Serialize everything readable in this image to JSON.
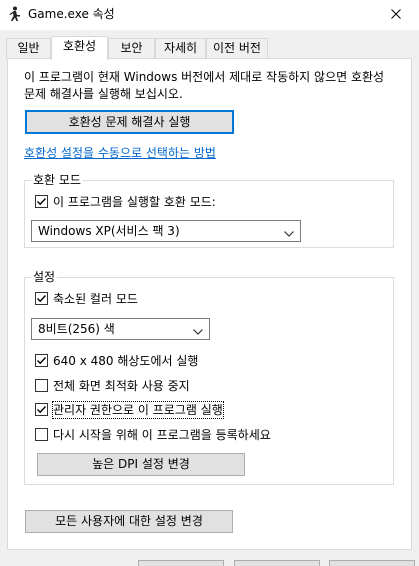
{
  "window": {
    "title": "Game.exe 속성"
  },
  "tabs": [
    {
      "label": "일반"
    },
    {
      "label": "호환성"
    },
    {
      "label": "보안"
    },
    {
      "label": "자세히"
    },
    {
      "label": "이전 버전"
    }
  ],
  "compat": {
    "info": "이 프로그램이 현재 Windows 버전에서 제대로 작동하지 않으면 호환성 문제 해결사를 실행해 보십시오.",
    "troubleshooter_label": "호환성 문제 해결사 실행",
    "manual_link": "호환성 설정을 수동으로 선택하는 방법",
    "mode_group": {
      "title": "호환 모드",
      "checkbox_label": "이 프로그램을 실행할 호환 모드:",
      "checked": true,
      "selected": "Windows XP(서비스 팩 3)"
    },
    "settings_group": {
      "title": "설정",
      "reduced_color": {
        "label": "축소된 컬러 모드",
        "checked": true
      },
      "color_select": "8비트(256) 색",
      "res_640": {
        "label": "640 x 480 해상도에서 실행",
        "checked": true
      },
      "disable_fullscreen": {
        "label": "전체 화면 최적화 사용 중지",
        "checked": false
      },
      "run_as_admin": {
        "label": "관리자 권한으로 이 프로그램 실행",
        "checked": true
      },
      "register_restart": {
        "label": "다시 시작을 위해 이 프로그램을 등록하세요",
        "checked": false
      },
      "dpi_button": "높은 DPI 설정 변경"
    },
    "all_users_button": "모든 사용자에 대한 설정 변경"
  }
}
